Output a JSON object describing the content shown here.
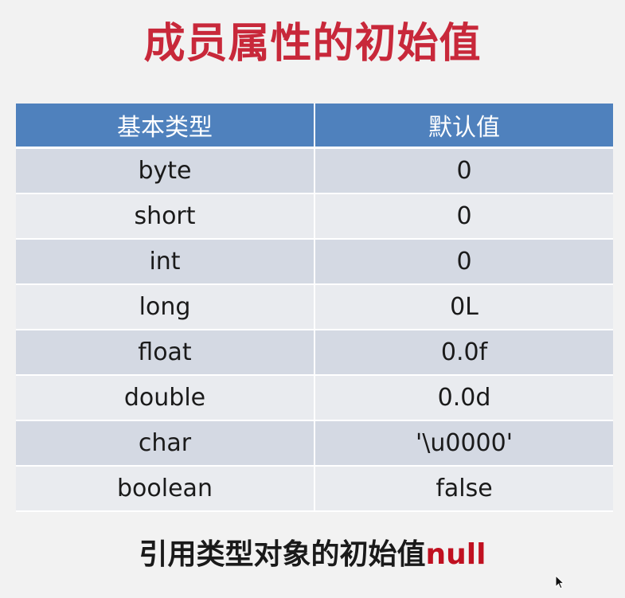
{
  "slide": {
    "title": "成员属性的初始值",
    "title_color": "#c8283a"
  },
  "table": {
    "header_color": "#4f81bd",
    "headers": [
      "基本类型",
      "默认值"
    ],
    "rows": [
      {
        "type": "byte",
        "default": "0"
      },
      {
        "type": "short",
        "default": "0"
      },
      {
        "type": "int",
        "default": "0"
      },
      {
        "type": "long",
        "default": "0L"
      },
      {
        "type": "float",
        "default": "0.0f"
      },
      {
        "type": "double",
        "default": "0.0d"
      },
      {
        "type": "char",
        "default": "'\\u0000'"
      },
      {
        "type": "boolean",
        "default": "false"
      }
    ]
  },
  "footer": {
    "text": "引用类型对象的初始值",
    "highlight": "null",
    "text_color": "#1a1a1a",
    "highlight_color": "#c01020"
  },
  "cursor": {
    "icon": "mouse-pointer-icon"
  }
}
